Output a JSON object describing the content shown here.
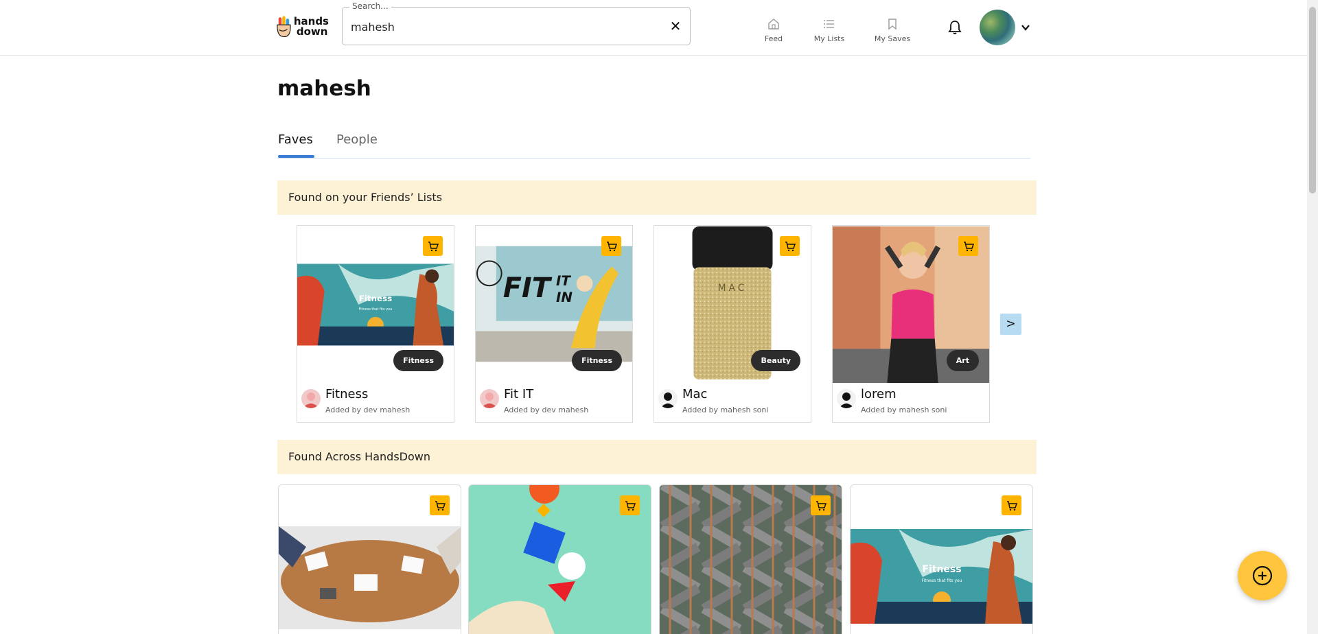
{
  "header": {
    "logo_text_line1": "hands",
    "logo_text_line2": "down",
    "search": {
      "label": "Search...",
      "value": "mahesh"
    },
    "clear_icon": "close-icon",
    "nav": [
      {
        "label": "Feed",
        "icon": "home-icon"
      },
      {
        "label": "My Lists",
        "icon": "list-icon"
      },
      {
        "label": "My Saves",
        "icon": "bookmark-icon"
      }
    ]
  },
  "main": {
    "title": "mahesh",
    "tabs": [
      {
        "label": "Faves",
        "active": true
      },
      {
        "label": "People",
        "active": false
      }
    ],
    "friends_section": {
      "heading": "Found on your Friends’ Lists",
      "next_label": ">",
      "cards": [
        {
          "title": "Fitness",
          "category": "Fitness",
          "added_by": "Added by dev mahesh"
        },
        {
          "title": "Fit IT",
          "category": "Fitness",
          "added_by": "Added by dev mahesh"
        },
        {
          "title": "Mac",
          "category": "Beauty",
          "added_by": "Added by mahesh soni"
        },
        {
          "title": "lorem",
          "category": "Art",
          "added_by": "Added by mahesh soni"
        }
      ]
    },
    "across_section": {
      "heading": "Found Across HandsDown"
    }
  },
  "images": {
    "fitness_title": "Fitness",
    "fitness_tagline": "Fitness that fits you",
    "fitit_line1": "FIT",
    "fitit_line2": "IT",
    "fitit_line3": "IN",
    "mac_brand": "MAC"
  },
  "colors": {
    "accent": "#3a7bd5",
    "cart": "#ffb400",
    "band": "#fdf1d6",
    "fab": "#ffc53d"
  }
}
